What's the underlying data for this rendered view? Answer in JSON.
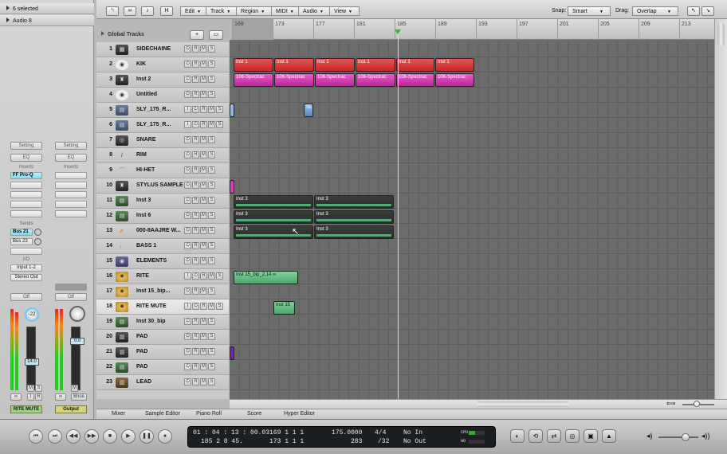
{
  "inspector": {
    "selection": "6 selected",
    "region_name": "Audio 8",
    "strip1": {
      "setting": "Setting",
      "eq": "EQ",
      "inserts": "Inserts",
      "plugin": "FF Pro-Q",
      "sends": "Sends",
      "send1": "Bus 21",
      "send2": "Bus 23",
      "io": "I/O",
      "input": "Input 1-2",
      "output": "Stereo Out",
      "mode": "Off",
      "pan": "-22",
      "volume": "14.0",
      "m": "M",
      "s": "S",
      "i": "I",
      "r": "R",
      "link": "∞",
      "name": "RITE MUTE"
    },
    "strip2": {
      "setting": "Setting",
      "eq": "EQ",
      "inserts": "Inserts",
      "mode": "Off",
      "volume": "0.0",
      "m": "M",
      "bnce": "Bnce",
      "link": "∞",
      "name": "Output"
    }
  },
  "toolbar": {
    "menus": [
      "Edit",
      "Track",
      "Region",
      "MIDI",
      "Audio",
      "View"
    ],
    "snap_label": "Snap:",
    "snap_value": "Smart",
    "drag_label": "Drag:",
    "drag_value": "Overlap",
    "h_button": "H"
  },
  "global_tracks": "Global Tracks",
  "ruler": [
    "169",
    "173",
    "177",
    "181",
    "185",
    "189",
    "193",
    "197",
    "201",
    "205",
    "209",
    "213"
  ],
  "tracks": [
    {
      "num": "1",
      "name": "SIDECHAINE",
      "extra": ""
    },
    {
      "num": "2",
      "name": "KIK",
      "extra": ""
    },
    {
      "num": "3",
      "name": "Inst 2",
      "extra": ""
    },
    {
      "num": "4",
      "name": "Untitled",
      "extra": ""
    },
    {
      "num": "5",
      "name": "SLY_175_R...",
      "extra": "I"
    },
    {
      "num": "6",
      "name": "SLY_175_R...",
      "extra": "I"
    },
    {
      "num": "7",
      "name": "SNARE",
      "extra": ""
    },
    {
      "num": "8",
      "name": "RIM",
      "extra": ""
    },
    {
      "num": "9",
      "name": "HI-HET",
      "extra": ""
    },
    {
      "num": "10",
      "name": "STYLUS SAMPLE",
      "extra": ""
    },
    {
      "num": "11",
      "name": "Inst 3",
      "extra": ""
    },
    {
      "num": "12",
      "name": "Inst 6",
      "extra": ""
    },
    {
      "num": "13",
      "name": "000-8AAJRE W...",
      "extra": ""
    },
    {
      "num": "14",
      "name": "BASS 1",
      "extra": ""
    },
    {
      "num": "15",
      "name": "ELEMENTS",
      "extra": ""
    },
    {
      "num": "16",
      "name": "RITE",
      "extra": "I"
    },
    {
      "num": "17",
      "name": "Inst 15_bip...",
      "extra": ""
    },
    {
      "num": "18",
      "name": "RITE MUTE",
      "extra": "I"
    },
    {
      "num": "19",
      "name": "Inst 30_bip",
      "extra": ""
    },
    {
      "num": "20",
      "name": "PAD",
      "extra": ""
    },
    {
      "num": "21",
      "name": "PAD",
      "extra": ""
    },
    {
      "num": "22",
      "name": "PAD",
      "extra": ""
    },
    {
      "num": "23",
      "name": "LEAD",
      "extra": ""
    }
  ],
  "regions": {
    "kik": [
      "Inst 1",
      "Inst 1",
      "Inst 1",
      "Inst 1",
      "Inst 1",
      "Inst 1"
    ],
    "inst2": [
      "106-Spectrac",
      "106-Spectrac",
      "106-Spectrac",
      "106-Spectrac",
      "106-Spectrac",
      "106-Spectrac"
    ],
    "sly": "SL",
    "inst3": [
      "Inst 3",
      "Inst 3"
    ],
    "inst6": [
      "Inst 3",
      "Inst 3"
    ],
    "track13": [
      "Inst 3",
      "Inst 3"
    ],
    "rite": "Inst 15_bip_2.14 ∞",
    "rite_mute": "Inst 15"
  },
  "tabs": [
    "Mixer",
    "Sample Editor",
    "Piano Roll",
    "Score",
    "Hyper Editor"
  ],
  "transport": {
    "smpte": "01 : 04 : 13 : 00.03",
    "bars": "185    2    8    45.",
    "pos1": "169    1    1    1",
    "pos2": "173    1    1    1",
    "tempo": "175.0000",
    "tempo2": "283",
    "sig": "4/4",
    "div": "/32",
    "in": "No In",
    "out": "No Out",
    "cpu": "CPU",
    "hd": "HD"
  }
}
